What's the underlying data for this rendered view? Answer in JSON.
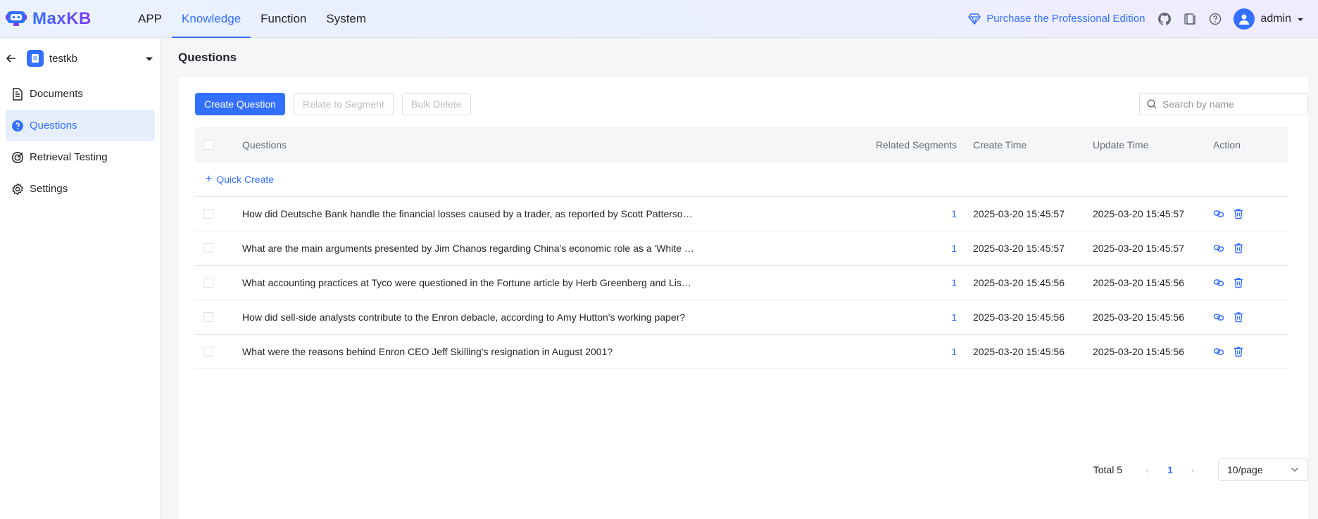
{
  "header": {
    "logo_text": "MaxKB",
    "nav": [
      {
        "label": "APP",
        "active": false
      },
      {
        "label": "Knowledge",
        "active": true
      },
      {
        "label": "Function",
        "active": false
      },
      {
        "label": "System",
        "active": false
      }
    ],
    "purchase_label": "Purchase the Professional Edition",
    "icons": [
      "github-icon",
      "book-icon",
      "help-icon"
    ],
    "user_name": "admin",
    "accent_color": "#3370ff"
  },
  "sidebar": {
    "kb_name": "testkb",
    "items": [
      {
        "label": "Documents",
        "icon": "document-icon",
        "active": false
      },
      {
        "label": "Questions",
        "icon": "question-circle-icon",
        "active": true
      },
      {
        "label": "Retrieval Testing",
        "icon": "target-icon",
        "active": false
      },
      {
        "label": "Settings",
        "icon": "gear-icon",
        "active": false
      }
    ]
  },
  "main": {
    "title": "Questions",
    "toolbar": {
      "create_label": "Create Question",
      "relate_label": "Relate to Segment",
      "bulk_delete_label": "Bulk Delete",
      "search_placeholder": "Search by name"
    },
    "table": {
      "columns": [
        "Questions",
        "Related Segments",
        "Create Time",
        "Update Time",
        "Action"
      ],
      "quick_create_label": "Quick Create",
      "rows": [
        {
          "question": "How did Deutsche Bank handle the financial losses caused by a trader, as reported by Scott Patterso…",
          "segments": "1",
          "create_time": "2025-03-20 15:45:57",
          "update_time": "2025-03-20 15:45:57"
        },
        {
          "question": "What are the main arguments presented by Jim Chanos regarding China's economic role as a 'White …",
          "segments": "1",
          "create_time": "2025-03-20 15:45:57",
          "update_time": "2025-03-20 15:45:57"
        },
        {
          "question": "What accounting practices at Tyco were questioned in the Fortune article by Herb Greenberg and Lis…",
          "segments": "1",
          "create_time": "2025-03-20 15:45:56",
          "update_time": "2025-03-20 15:45:56"
        },
        {
          "question": "How did sell-side analysts contribute to the Enron debacle, according to Amy Hutton's working paper?",
          "segments": "1",
          "create_time": "2025-03-20 15:45:56",
          "update_time": "2025-03-20 15:45:56"
        },
        {
          "question": "What were the reasons behind Enron CEO Jeff Skilling's resignation in August 2001?",
          "segments": "1",
          "create_time": "2025-03-20 15:45:56",
          "update_time": "2025-03-20 15:45:56"
        }
      ]
    },
    "pagination": {
      "total_label": "Total 5",
      "current_page": "1",
      "page_size": "10/page"
    }
  }
}
